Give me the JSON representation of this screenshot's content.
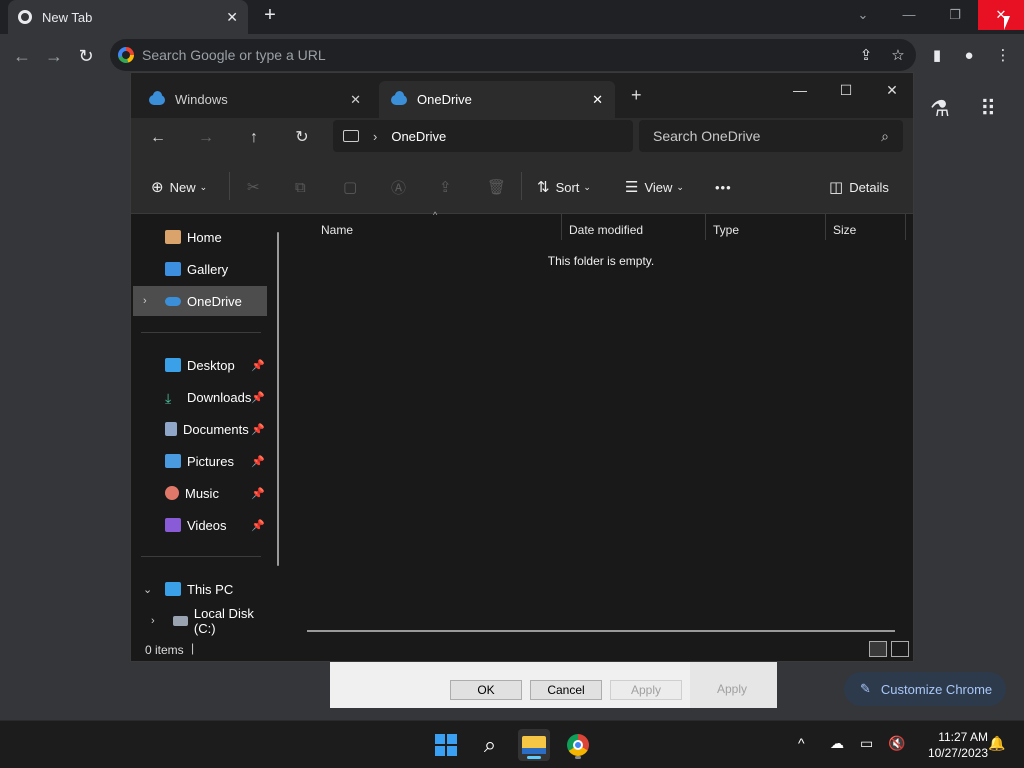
{
  "chrome": {
    "tab_title": "New Tab",
    "tab_close": "✕",
    "new_tab": "+",
    "omnibox_placeholder": "Search Google or type a URL",
    "customize_label": "Customize Chrome"
  },
  "explorer": {
    "tabs": [
      {
        "label": "Windows",
        "close": "✕"
      },
      {
        "label": "OneDrive",
        "close": "✕"
      }
    ],
    "new_tab": "+",
    "address_path": "OneDrive",
    "search_placeholder": "Search OneDrive",
    "commands": {
      "new": "New",
      "sort": "Sort",
      "view": "View",
      "more": "•••",
      "details": "Details"
    },
    "sidebar": {
      "quick": [
        {
          "label": "Home"
        },
        {
          "label": "Gallery"
        },
        {
          "label": "OneDrive"
        }
      ],
      "pinned": [
        {
          "label": "Desktop"
        },
        {
          "label": "Downloads"
        },
        {
          "label": "Documents"
        },
        {
          "label": "Pictures"
        },
        {
          "label": "Music"
        },
        {
          "label": "Videos"
        }
      ],
      "this_pc": "This PC",
      "local_disk": "Local Disk (C:)"
    },
    "columns": [
      "Name",
      "Date modified",
      "Type",
      "Size"
    ],
    "empty_message": "This folder is empty.",
    "status": "0 items"
  },
  "dialog": {
    "ok": "OK",
    "cancel": "Cancel",
    "apply": "Apply",
    "apply2": "Apply"
  },
  "taskbar": {
    "time": "11:27 AM",
    "date": "10/27/2023"
  }
}
